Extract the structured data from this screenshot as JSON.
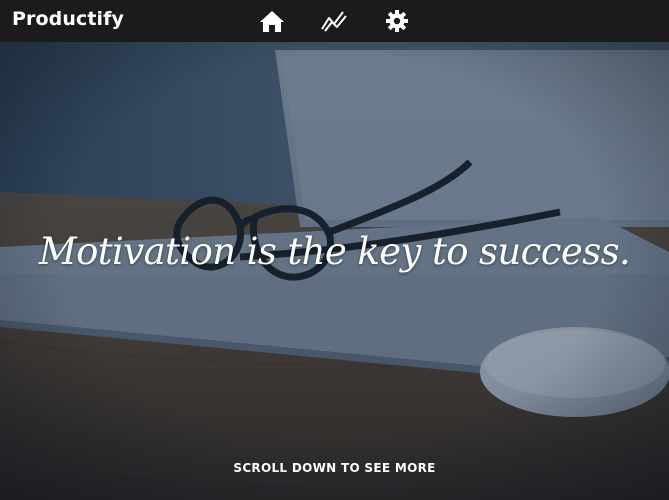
{
  "navbar": {
    "brand": "Productify",
    "icons": [
      "home-icon",
      "stats-icon",
      "settings-icon"
    ]
  },
  "hero": {
    "quote": "Motivation is the key to success.",
    "scroll_hint": "SCROLL DOWN TO SEE MORE"
  },
  "colors": {
    "navbar_bg": "#1b1b1b",
    "text": "#ffffff",
    "overlay": "#122640"
  }
}
